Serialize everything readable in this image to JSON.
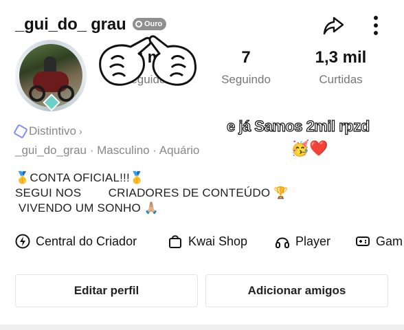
{
  "profile": {
    "username": "_gui_do_ grau",
    "badge": "Ouro",
    "stats": [
      {
        "value": "2 mil",
        "label": "Seguidores"
      },
      {
        "value": "7",
        "label": "Seguindo"
      },
      {
        "value": "1,3 mil",
        "label": "Curtidas"
      }
    ],
    "distintivo": "Distintivo",
    "meta": "_gui_do_grau · Masculino · Aquário",
    "overlay_text": "e já Samos 2mil  rpzd",
    "overlay_emojis": "🥳❤️",
    "bio_lines": [
      "🥇CONTA OFICIAL!!!🥇",
      "SEGUI NOS        CRIADORES DE CONTEÚDO 🏆",
      " VIVENDO UM SONHO 🙏🏼"
    ]
  },
  "links": [
    {
      "label": "Central do Criador",
      "icon": "lightning-circle-icon"
    },
    {
      "label": "Kwai Shop",
      "icon": "shopping-bag-icon"
    },
    {
      "label": "Player",
      "icon": "headphones-icon"
    },
    {
      "label": "Gam",
      "icon": "gamepad-icon"
    }
  ],
  "buttons": {
    "edit": "Editar perfil",
    "add": "Adicionar amigos"
  },
  "icons": {
    "share": "share-icon",
    "more": "more-vertical-icon"
  },
  "colors": {
    "badge_bg": "#8f8f8f",
    "muted_text": "#888888",
    "distintivo_accent": "#7b8cff"
  }
}
